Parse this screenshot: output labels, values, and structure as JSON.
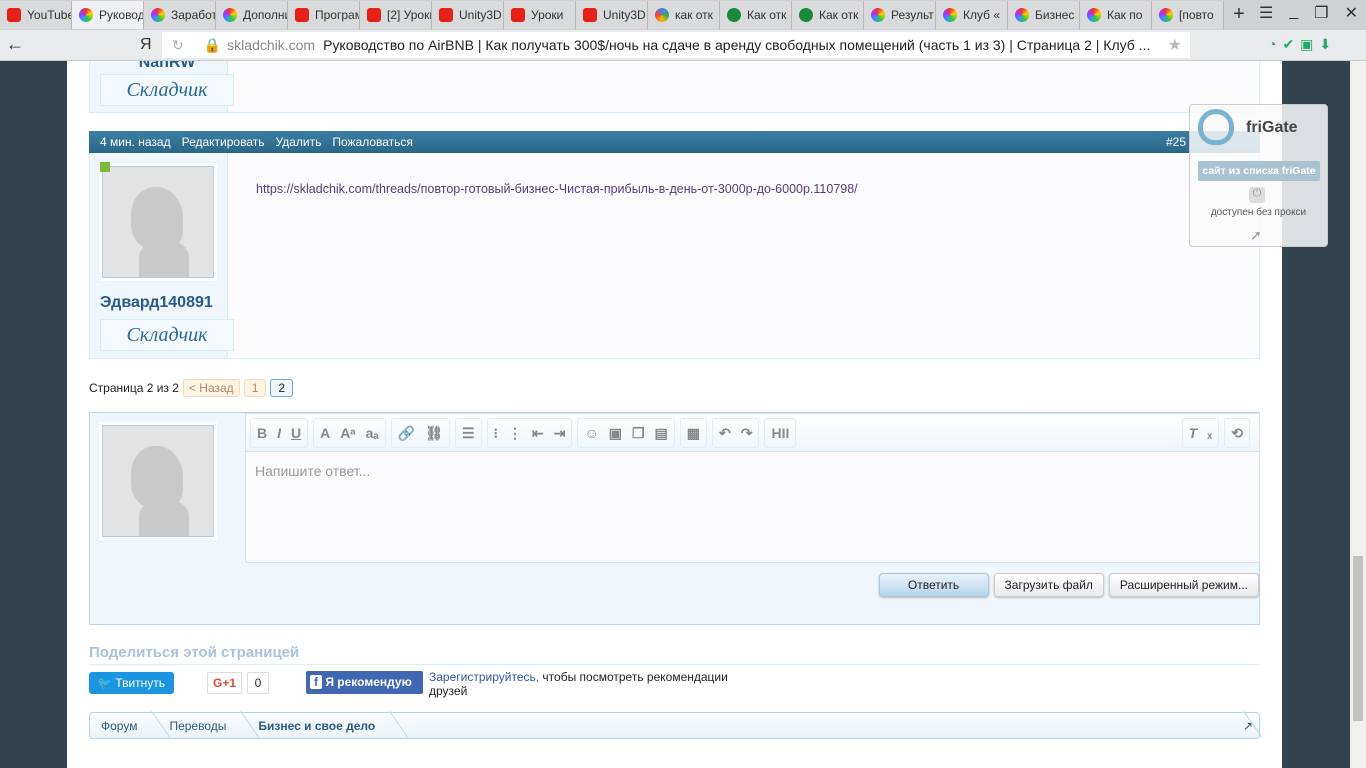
{
  "tabs": [
    {
      "label": "YouTube",
      "icon": "yt"
    },
    {
      "label": "Руководство",
      "icon": "col",
      "active": true
    },
    {
      "label": "Заработок",
      "icon": "col"
    },
    {
      "label": "Дополнительно",
      "icon": "col"
    },
    {
      "label": "Программа",
      "icon": "yt"
    },
    {
      "label": "[2] Уроки",
      "icon": "yt"
    },
    {
      "label": "Unity3D",
      "icon": "yt"
    },
    {
      "label": "Уроки",
      "icon": "yt"
    },
    {
      "label": "Unity3D",
      "icon": "yt"
    },
    {
      "label": "как отк",
      "icon": "g"
    },
    {
      "label": "Как отк",
      "icon": "sb"
    },
    {
      "label": "Как отк",
      "icon": "sb"
    },
    {
      "label": "Результ",
      "icon": "col"
    },
    {
      "label": "Клуб «",
      "icon": "col"
    },
    {
      "label": "Бизнес",
      "icon": "col"
    },
    {
      "label": "Как по",
      "icon": "col"
    },
    {
      "label": "[повто",
      "icon": "col"
    }
  ],
  "address": {
    "domain": "skladchik.com",
    "title": "Руководство по AirBNB | Как получать 300$/ночь на сдаче в аренду свободных помещений (часть 1 из 3) | Страница 2 | Клуб ...",
    "yandex": "Я"
  },
  "prev_post": {
    "rank": "Складчик",
    "username_partial": "NanRW"
  },
  "post": {
    "time": "4 мин. назад",
    "actions": [
      "Редактировать",
      "Удалить",
      "Пожаловаться"
    ],
    "number": "#25",
    "reply": "Ответить",
    "username": "Эдвард140891",
    "rank": "Складчик",
    "link": "https://skladchik.com/threads/повтор-готовый-бизнес-Чистая-прибыль-в-день-от-3000р-до-6000р.110798/"
  },
  "frigate": {
    "title": "friGate",
    "status": "сайт из списка friGate",
    "note": "доступен без прокси"
  },
  "pagination": {
    "label": "Страница 2 из 2",
    "prev": "< Назад",
    "pages": [
      "1",
      "2"
    ],
    "current": "2"
  },
  "editor": {
    "placeholder": "Напишите ответ...",
    "buttons": {
      "reply": "Ответить",
      "upload": "Загрузить файл",
      "advanced": "Расширенный режим..."
    }
  },
  "share": {
    "title": "Поделиться этой страницей",
    "tweet": "Твитнуть",
    "gplus": "G+1",
    "gplus_count": "0",
    "fb": "Я рекомендую",
    "fb_note_link": "Зарегистрируйтесь,",
    "fb_note": " чтобы посмотреть рекомендации друзей"
  },
  "breadcrumb": [
    "Форум",
    "Переводы",
    "Бизнес и свое дело"
  ]
}
